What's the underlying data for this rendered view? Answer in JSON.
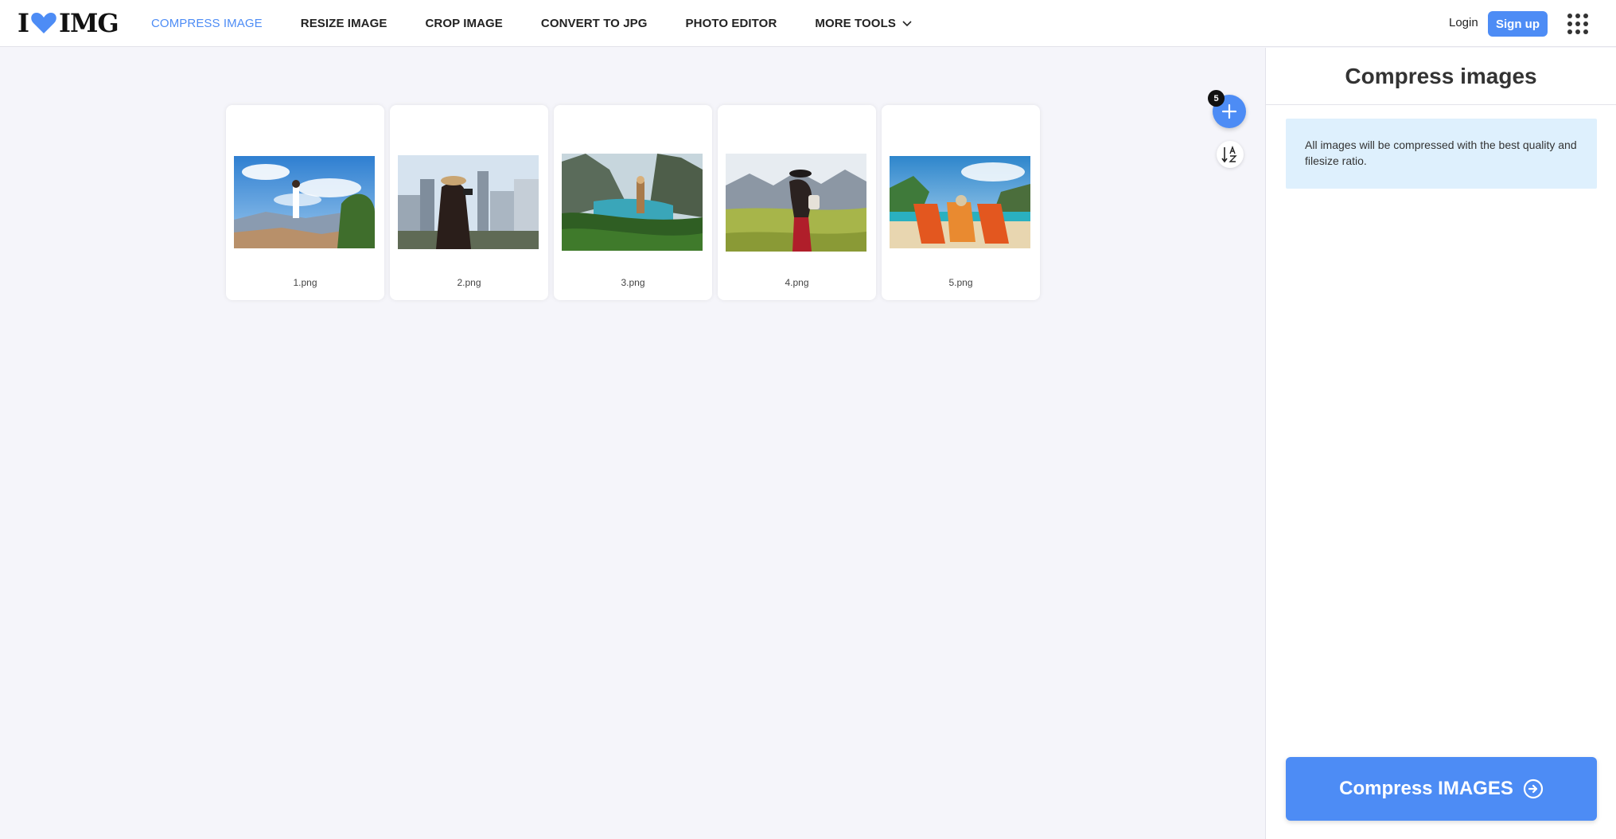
{
  "header": {
    "logo_left": "I",
    "logo_right": "IMG",
    "nav": [
      {
        "label": "COMPRESS IMAGE",
        "active": true
      },
      {
        "label": "RESIZE IMAGE",
        "active": false
      },
      {
        "label": "CROP IMAGE",
        "active": false
      },
      {
        "label": "CONVERT TO JPG",
        "active": false
      },
      {
        "label": "PHOTO EDITOR",
        "active": false
      },
      {
        "label": "MORE TOOLS",
        "active": false
      }
    ],
    "login": "Login",
    "signup": "Sign up"
  },
  "workspace": {
    "files": [
      {
        "name": "1.png"
      },
      {
        "name": "2.png"
      },
      {
        "name": "3.png"
      },
      {
        "name": "4.png"
      },
      {
        "name": "5.png"
      }
    ],
    "file_count": "5"
  },
  "sidebar": {
    "title": "Compress images",
    "info": "All images will be compressed with the best quality and filesize ratio.",
    "action_label": "Compress IMAGES"
  },
  "colors": {
    "accent": "#4d8cf5",
    "info_bg": "#def0fd",
    "workspace_bg": "#f5f5fa"
  },
  "icons": {
    "logo_heart": "heart-icon",
    "more_tools": "chevron-down-icon",
    "apps": "grid-dots-icon",
    "add": "plus-icon",
    "sort": "sort-alpha-icon",
    "submit": "arrow-right-circle-icon"
  }
}
